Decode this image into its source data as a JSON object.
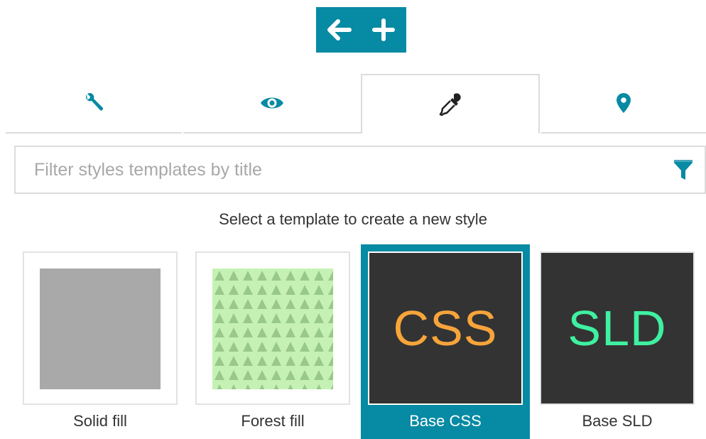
{
  "toolbar": {
    "back_icon": "arrow-left-icon",
    "add_icon": "plus-icon",
    "background": "#078aa3"
  },
  "tabs": [
    {
      "icon": "wrench-icon",
      "active": false
    },
    {
      "icon": "eye-icon",
      "active": false
    },
    {
      "icon": "eyedropper-icon",
      "active": true
    },
    {
      "icon": "map-marker-icon",
      "active": false
    }
  ],
  "filter": {
    "placeholder": "Filter styles templates by title",
    "value": "",
    "icon": "filter-icon"
  },
  "hint": "Select a template to create a new style",
  "templates": [
    {
      "label": "Solid fill",
      "selected": false,
      "preview": "solid",
      "color": "#a9a9a9"
    },
    {
      "label": "Forest fill",
      "selected": false,
      "preview": "pattern",
      "color": "#c5f2b4"
    },
    {
      "label": "Base CSS",
      "selected": true,
      "preview_text": "CSS",
      "color": "#f7a43b"
    },
    {
      "label": "Base SLD",
      "selected": false,
      "preview_text": "SLD",
      "color": "#3ff0a0"
    }
  ],
  "colors": {
    "accent": "#078aa3",
    "tab_icon": "#078aa3",
    "dark_preview": "#333333"
  }
}
